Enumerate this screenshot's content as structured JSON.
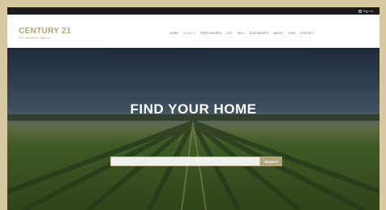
{
  "topbar": {
    "signin_label": "Sign In"
  },
  "header": {
    "logo_text": "CENTURY 21",
    "logo_sub": "The Hamptons Agency",
    "nav": [
      "HOME",
      "SEARCH",
      "OPEN HOUSES",
      "LIST",
      "SELL",
      "OUR AGENTS",
      "ABOUT",
      "JOIN",
      "CONTACT"
    ]
  },
  "hero": {
    "title": "FIND YOUR HOME",
    "search_placeholder": "",
    "search_button": "SEARCH"
  },
  "colors": {
    "brand_gold": "#b5a77c",
    "topbar": "#1b1b1b",
    "frame": "#d8c9a2"
  }
}
